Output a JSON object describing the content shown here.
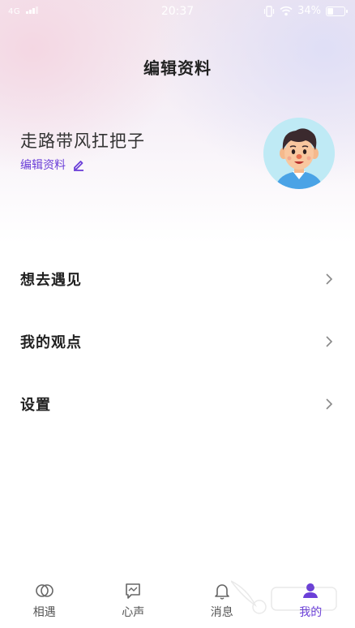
{
  "status_bar": {
    "network": "4G",
    "time": "20:37",
    "battery": "34%",
    "battery_level": 0.34
  },
  "header": {
    "title": "编辑资料"
  },
  "profile": {
    "name": "走路带风扛把子",
    "edit_label": "编辑资料"
  },
  "menu": {
    "items": [
      {
        "label": "想去遇见"
      },
      {
        "label": "我的观点"
      },
      {
        "label": "设置"
      }
    ]
  },
  "tabbar": {
    "tabs": [
      {
        "label": "相遇",
        "icon": "meet-icon"
      },
      {
        "label": "心声",
        "icon": "chat-icon"
      },
      {
        "label": "消息",
        "icon": "bell-icon"
      },
      {
        "label": "我的",
        "icon": "profile-icon"
      }
    ],
    "active_index": 3
  },
  "colors": {
    "accent": "#6b3fd8",
    "text": "#222222"
  }
}
